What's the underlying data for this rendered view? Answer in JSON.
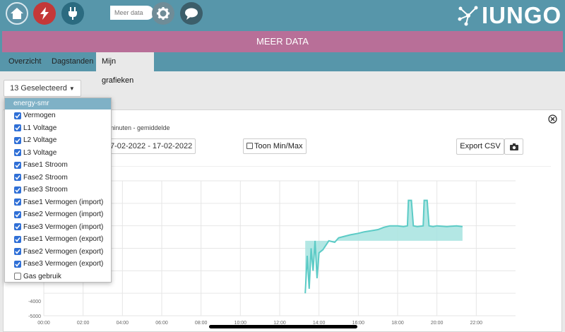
{
  "nav": {
    "icons": [
      "home-icon",
      "lightning-icon",
      "plug-icon",
      "chart-icon",
      "gear-icon",
      "chat-bubble-icon"
    ],
    "tooltip": "Meer data",
    "logo_text": "IUNGO"
  },
  "page_title": "MEER DATA",
  "tabs": [
    {
      "label": "Overzicht",
      "active": false
    },
    {
      "label": "Dagstanden",
      "active": false
    },
    {
      "label": "Mijn grafieken",
      "active": true
    }
  ],
  "toolbar": {
    "select_label": "13 Geselecteerd",
    "subtitle": "minuten - gemiddelde",
    "date_range": "7-02-2022 - 17-02-2022",
    "minmax_label": "Toon Min/Max",
    "export_label": "Export CSV"
  },
  "dropdown": {
    "group": "energy-smr",
    "items": [
      {
        "label": "Vermogen",
        "checked": true
      },
      {
        "label": "L1 Voltage",
        "checked": true
      },
      {
        "label": "L2 Voltage",
        "checked": true
      },
      {
        "label": "L3 Voltage",
        "checked": true
      },
      {
        "label": "Fase1 Stroom",
        "checked": true
      },
      {
        "label": "Fase2 Stroom",
        "checked": true
      },
      {
        "label": "Fase3 Stroom",
        "checked": true
      },
      {
        "label": "Fase1 Vermogen (import)",
        "checked": true
      },
      {
        "label": "Fase2 Vermogen (import)",
        "checked": true
      },
      {
        "label": "Fase3 Vermogen (import)",
        "checked": true
      },
      {
        "label": "Fase1 Vermogen (export)",
        "checked": true
      },
      {
        "label": "Fase2 Vermogen (export)",
        "checked": true
      },
      {
        "label": "Fase3 Vermogen (export)",
        "checked": true
      },
      {
        "label": "Gas gebruik",
        "checked": false
      }
    ]
  },
  "colors": {
    "accent": "#5796aa",
    "title_bar": "#b86f98",
    "series": "#5ccbc6",
    "checkbox": "#2f6fd6"
  },
  "chart_data": {
    "type": "area",
    "x_ticks": [
      "00:00",
      "02:00",
      "04:00",
      "06:00",
      "08:00",
      "10:00",
      "12:00",
      "14:00",
      "16:00",
      "18:00",
      "20:00",
      "22:00"
    ],
    "y_ticks": [
      "-4000",
      "-5000"
    ],
    "xlim": [
      0,
      24
    ],
    "ylim": [
      -5000,
      4000
    ],
    "grid": true,
    "series": [
      {
        "x": [
          13.3,
          13.4,
          13.5,
          13.6,
          13.7,
          13.8,
          13.9,
          14.0,
          14.2,
          14.5,
          14.8,
          15.0,
          15.3,
          15.6,
          16.0,
          16.3,
          16.8,
          17.0,
          17.3,
          17.6,
          18.0,
          18.3,
          18.5,
          18.55,
          18.7,
          18.8,
          19.0,
          19.3,
          19.35,
          19.5,
          19.6,
          19.8,
          20.0,
          20.5,
          21.0,
          21.3
        ],
        "y": [
          -3500,
          -1000,
          -3200,
          -500,
          -2000,
          0,
          -2500,
          -800,
          -600,
          0,
          -100,
          200,
          300,
          400,
          500,
          600,
          700,
          750,
          900,
          1000,
          1000,
          950,
          1000,
          2700,
          2700,
          1000,
          950,
          1000,
          2700,
          2700,
          1000,
          950,
          1000,
          950,
          1000,
          950
        ]
      }
    ]
  }
}
